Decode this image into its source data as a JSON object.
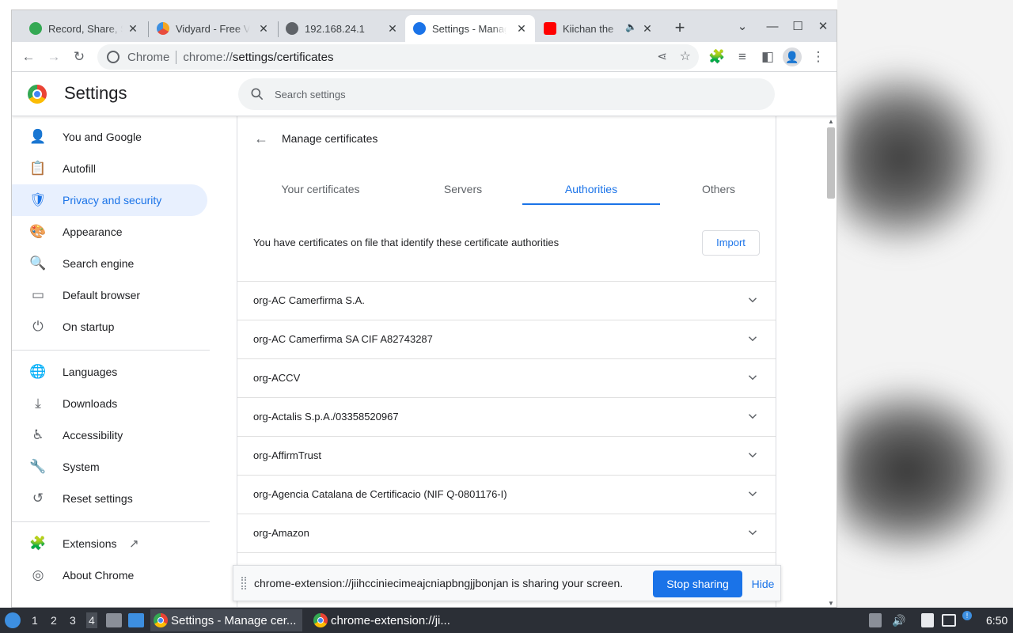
{
  "tabs": [
    {
      "title": "Record, Share, Send Your Video",
      "active": false,
      "color": "#34a853",
      "close": "✕"
    },
    {
      "title": "Vidyard - Free Video Recorder",
      "active": false,
      "color": "#f5a623",
      "close": "✕"
    },
    {
      "title": "192.168.24.1",
      "active": false,
      "color": "#5f6368",
      "close": "✕"
    },
    {
      "title": "Settings - Manage certificates",
      "active": true,
      "color": "#1a73e8",
      "close": "✕"
    },
    {
      "title": "Kiichan the",
      "active": false,
      "color": "#ff0000",
      "close": "✕"
    }
  ],
  "tab_audio_icon": "🔈",
  "newtab_label": "+",
  "window_controls": {
    "dropdown": "⌄",
    "minimize": "—",
    "maximize": "☐",
    "close": "✕"
  },
  "omnibox": {
    "chip": "Chrome",
    "scheme": "chrome://",
    "path": "settings/certificates"
  },
  "settings": {
    "title": "Settings",
    "search_placeholder": "Search settings"
  },
  "sidebar": {
    "items": [
      {
        "label": "You and Google",
        "icon": "person-icon",
        "glyph": "👤",
        "active": false
      },
      {
        "label": "Autofill",
        "icon": "clipboard-icon",
        "glyph": "📋",
        "active": false
      },
      {
        "label": "Privacy and security",
        "icon": "shield-icon",
        "glyph": "🛡",
        "active": true
      },
      {
        "label": "Appearance",
        "icon": "palette-icon",
        "glyph": "🎨",
        "active": false
      },
      {
        "label": "Search engine",
        "icon": "search-icon",
        "glyph": "🔍",
        "active": false
      },
      {
        "label": "Default browser",
        "icon": "browser-icon",
        "glyph": "▭",
        "active": false
      },
      {
        "label": "On startup",
        "icon": "power-icon",
        "glyph": "⏻",
        "active": false
      }
    ],
    "advanced": [
      {
        "label": "Languages",
        "icon": "globe-icon",
        "glyph": "🌐"
      },
      {
        "label": "Downloads",
        "icon": "download-icon",
        "glyph": "⤓"
      },
      {
        "label": "Accessibility",
        "icon": "accessibility-icon",
        "glyph": "♿"
      },
      {
        "label": "System",
        "icon": "wrench-icon",
        "glyph": "🔧"
      },
      {
        "label": "Reset settings",
        "icon": "history-icon",
        "glyph": "↺"
      }
    ],
    "footer": [
      {
        "label": "Extensions",
        "icon": "puzzle-icon",
        "glyph": "🧩"
      },
      {
        "label": "About Chrome",
        "icon": "chrome-icon",
        "glyph": "◎"
      }
    ]
  },
  "certs": {
    "title": "Manage certificates",
    "tabs": [
      "Your certificates",
      "Servers",
      "Authorities",
      "Others"
    ],
    "selected_tab": "Authorities",
    "description": "You have certificates on file that identify these certificate authorities",
    "import_label": "Import",
    "authorities": [
      "org-AC Camerfirma S.A.",
      "org-AC Camerfirma SA CIF A82743287",
      "org-ACCV",
      "org-Actalis S.p.A./03358520967",
      "org-AffirmTrust",
      "org-Agencia Catalana de Certificacio (NIF Q-0801176-I)",
      "org-Amazon"
    ]
  },
  "share_bar": {
    "text": "chrome-extension://jiihcciniecimeajcniapbngjjbonjan is sharing your screen.",
    "stop_label": "Stop sharing",
    "hide_label": "Hide"
  },
  "taskbar": {
    "workspaces": [
      "1",
      "2",
      "3",
      "4"
    ],
    "current_workspace": "4",
    "tasks": [
      {
        "label": "Settings - Manage cer...",
        "active": true
      },
      {
        "label": "chrome-extension://ji...",
        "active": false
      }
    ],
    "clock": "6:50"
  }
}
